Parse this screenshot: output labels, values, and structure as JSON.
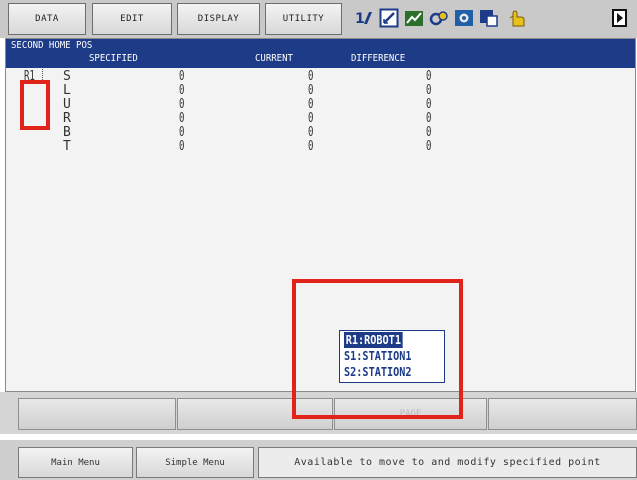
{
  "menu": {
    "items": [
      {
        "label": "DATA"
      },
      {
        "label": "EDIT"
      },
      {
        "label": "DISPLAY"
      },
      {
        "label": "UTILITY"
      }
    ]
  },
  "toolbar_icons": [
    "axis-swap-icon",
    "edit-box-icon",
    "graph-icon",
    "tools-icon",
    "image-icon",
    "frame-icon",
    "hand-icon",
    "play-icon"
  ],
  "screen": {
    "title": "SECOND HOME POS",
    "columns": {
      "specified": "SPECIFIED",
      "current": "CURRENT",
      "difference": "DIFFERENCE"
    },
    "group_label": "R1",
    "rows": [
      {
        "axis": "S",
        "specified": "0",
        "current": "0",
        "difference": "0"
      },
      {
        "axis": "L",
        "specified": "0",
        "current": "0",
        "difference": "0"
      },
      {
        "axis": "U",
        "specified": "0",
        "current": "0",
        "difference": "0"
      },
      {
        "axis": "R",
        "specified": "0",
        "current": "0",
        "difference": "0"
      },
      {
        "axis": "B",
        "specified": "0",
        "current": "0",
        "difference": "0"
      },
      {
        "axis": "T",
        "specified": "0",
        "current": "0",
        "difference": "0"
      }
    ],
    "popup": {
      "items": [
        {
          "label": "R1:ROBOT1",
          "selected": true
        },
        {
          "label": "S1:STATION1",
          "selected": false
        },
        {
          "label": "S2:STATION2",
          "selected": false
        }
      ]
    }
  },
  "function_keys": [
    "",
    "",
    "PAGE",
    ""
  ],
  "bottom": {
    "main_menu": "Main Menu",
    "simple_menu": "Simple Menu",
    "status": "Available to move to and modify specified point"
  },
  "colors": {
    "title_bar": "#1e3b88",
    "annotation": "#e2231a",
    "menu_bg": "#c9c9c9"
  }
}
